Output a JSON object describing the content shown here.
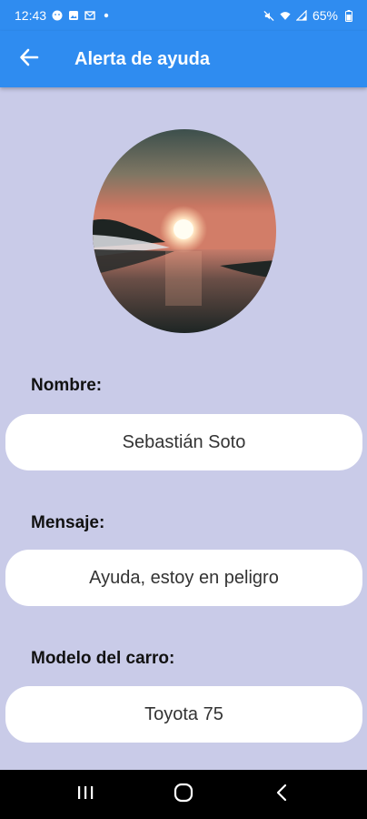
{
  "status_bar": {
    "time": "12:43",
    "battery": "65%",
    "icons": [
      "face-icon",
      "image-icon",
      "mail-icon",
      "dot-icon",
      "mute-icon",
      "wifi-icon",
      "signal-icon",
      "battery-icon"
    ]
  },
  "app_bar": {
    "title": "Alerta de ayuda",
    "back_icon": "arrow-left-icon",
    "color": "#2f8cf0"
  },
  "profile": {
    "image": "sunset-over-lake-photo"
  },
  "form": {
    "name_label": "Nombre:",
    "name_value": "Sebastián Soto",
    "message_label": "Mensaje:",
    "message_value": "Ayuda, estoy en peligro",
    "car_label": "Modelo del carro:",
    "car_value": "Toyota 75"
  },
  "nav_bar": {
    "icons": [
      "recent-apps-icon",
      "home-icon",
      "back-icon"
    ]
  },
  "colors": {
    "background": "#c9cbe8",
    "field": "#ffffff"
  }
}
